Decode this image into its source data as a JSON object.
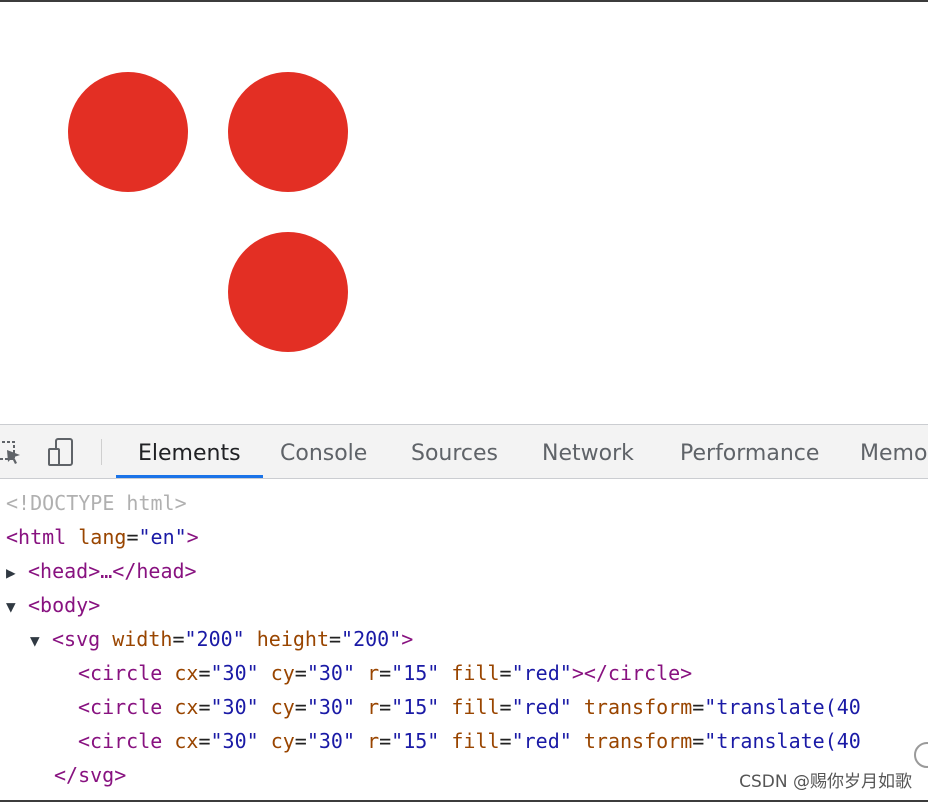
{
  "viewport": {
    "circles": [
      {
        "fill": "#e32f24"
      },
      {
        "fill": "#e32f24"
      },
      {
        "fill": "#e32f24"
      }
    ]
  },
  "devtools": {
    "tabs": [
      "Elements",
      "Console",
      "Sources",
      "Network",
      "Performance",
      "Memo"
    ],
    "active_tab": "Elements",
    "accent_color": "#1a73e8"
  },
  "dom": {
    "doctype": "<!DOCTYPE html>",
    "html_open": "<html",
    "html_lang_attr": "lang",
    "html_lang_value": "\"en\"",
    "html_close_bracket": ">",
    "head_collapsed": "<head>…</head>",
    "body_open": "<body>",
    "svg_tag": "<svg",
    "svg_width_attr": "width",
    "svg_width_value": "\"200\"",
    "svg_height_attr": "height",
    "svg_height_value": "\"200\"",
    "svg_close_bracket": ">",
    "circle_tag": "<circle",
    "cx_attr": "cx",
    "cx_value": "\"30\"",
    "cy_attr": "cy",
    "cy_value": "\"30\"",
    "r_attr": "r",
    "r_value": "\"15\"",
    "fill_attr": "fill",
    "fill_value": "\"red\"",
    "circle_end_tag": "></circle>",
    "transform_attr": "transform",
    "transform_value_1": "\"translate(40",
    "transform_value_2": "\"translate(40",
    "svg_close": "</svg>",
    "equals": "="
  },
  "watermark": "CSDN @赐你岁月如歌"
}
